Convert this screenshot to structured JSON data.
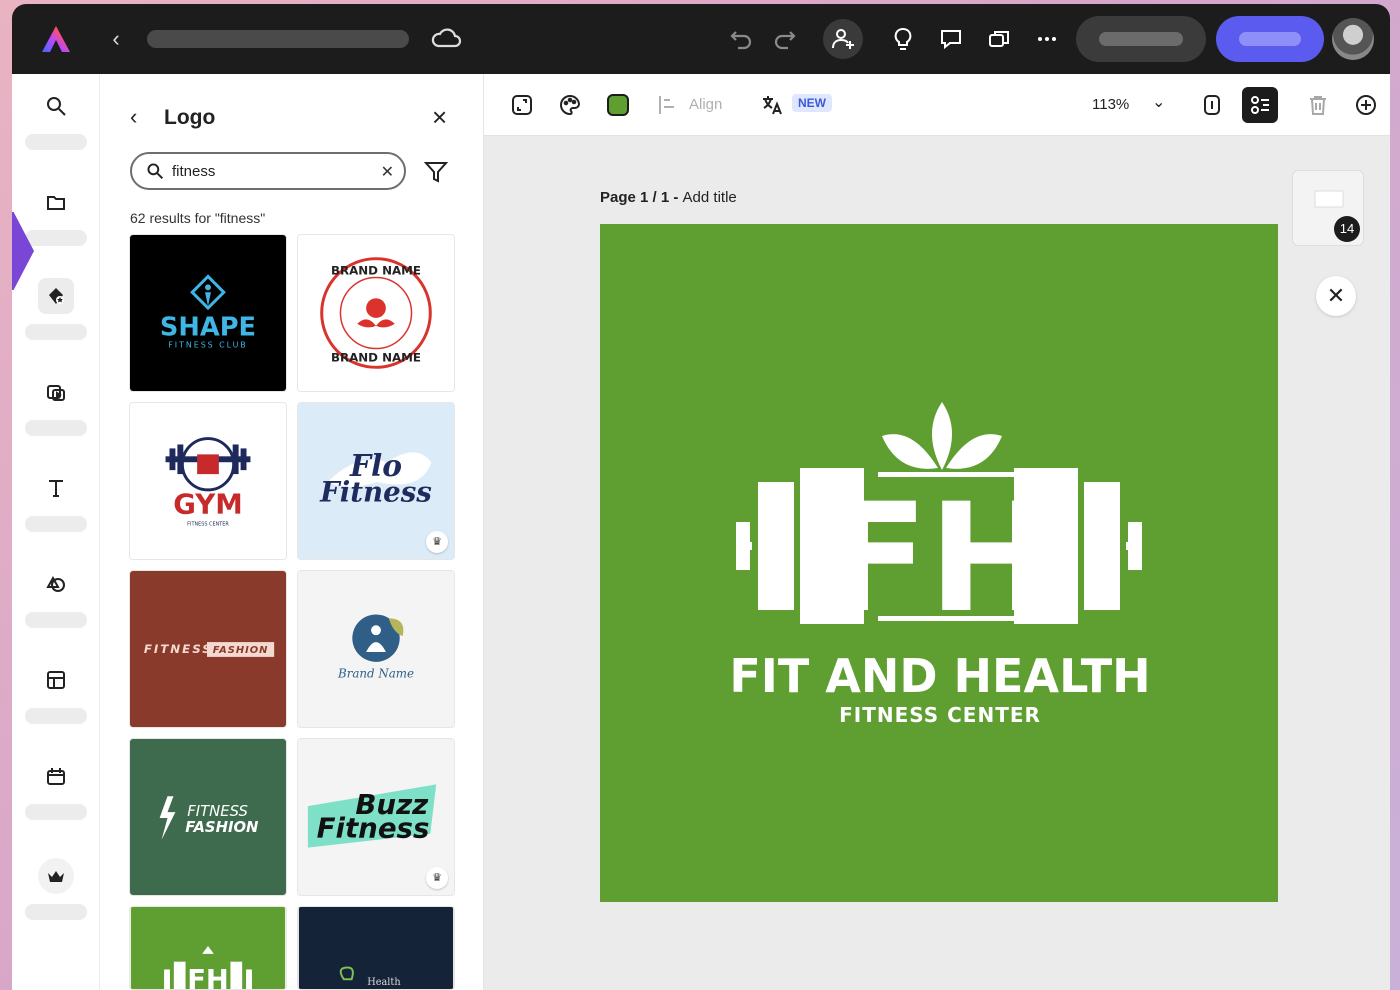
{
  "colors": {
    "topbar": "#1c1c1c",
    "accent_blue": "#5b5bef",
    "rail_marker": "#7a46d6",
    "artboard_green": "#5f9e31"
  },
  "topbar": {
    "icons": [
      "adobe-express-logo-icon",
      "back-chevron-icon",
      "cloud-icon",
      "undo-icon",
      "redo-icon",
      "invite-icon",
      "lightbulb-icon",
      "comment-icon",
      "share-icon",
      "more-icon"
    ]
  },
  "rail": {
    "items": [
      "search-icon",
      "folder-icon",
      "brand-icon",
      "media-icon",
      "text-icon",
      "elements-icon",
      "templates-icon",
      "schedule-icon",
      "premium-icon"
    ]
  },
  "panel": {
    "title": "Logo",
    "search_value": "fitness",
    "results_text": "62 results for \"fitness\""
  },
  "tiles": [
    {
      "label": "SHAPE",
      "sub": "FITNESS CLUB"
    },
    {
      "label": "BRAND NAME"
    },
    {
      "label": "GYM",
      "sub": "FITNESS CENTER"
    },
    {
      "label": "Flo",
      "sub": "Fitness"
    },
    {
      "label": "FITNESS",
      "sub": "FASHION"
    },
    {
      "label": "Brand Name"
    },
    {
      "label": "FITNESS",
      "sub": "FASHION"
    },
    {
      "label": "Buzz",
      "sub": "Fitness"
    },
    {
      "label": "FH"
    },
    {
      "label": "Health"
    }
  ],
  "toolbar": {
    "align_label": "Align",
    "new_badge": "NEW",
    "zoom": "113%"
  },
  "canvas": {
    "page_label_bold": "Page 1 / 1 - ",
    "page_label_rest": "Add title",
    "thumb_count": "14",
    "logo_monogram": "FH",
    "logo_title": "FIT AND HEALTH",
    "logo_subtitle": "FITNESS CENTER"
  }
}
